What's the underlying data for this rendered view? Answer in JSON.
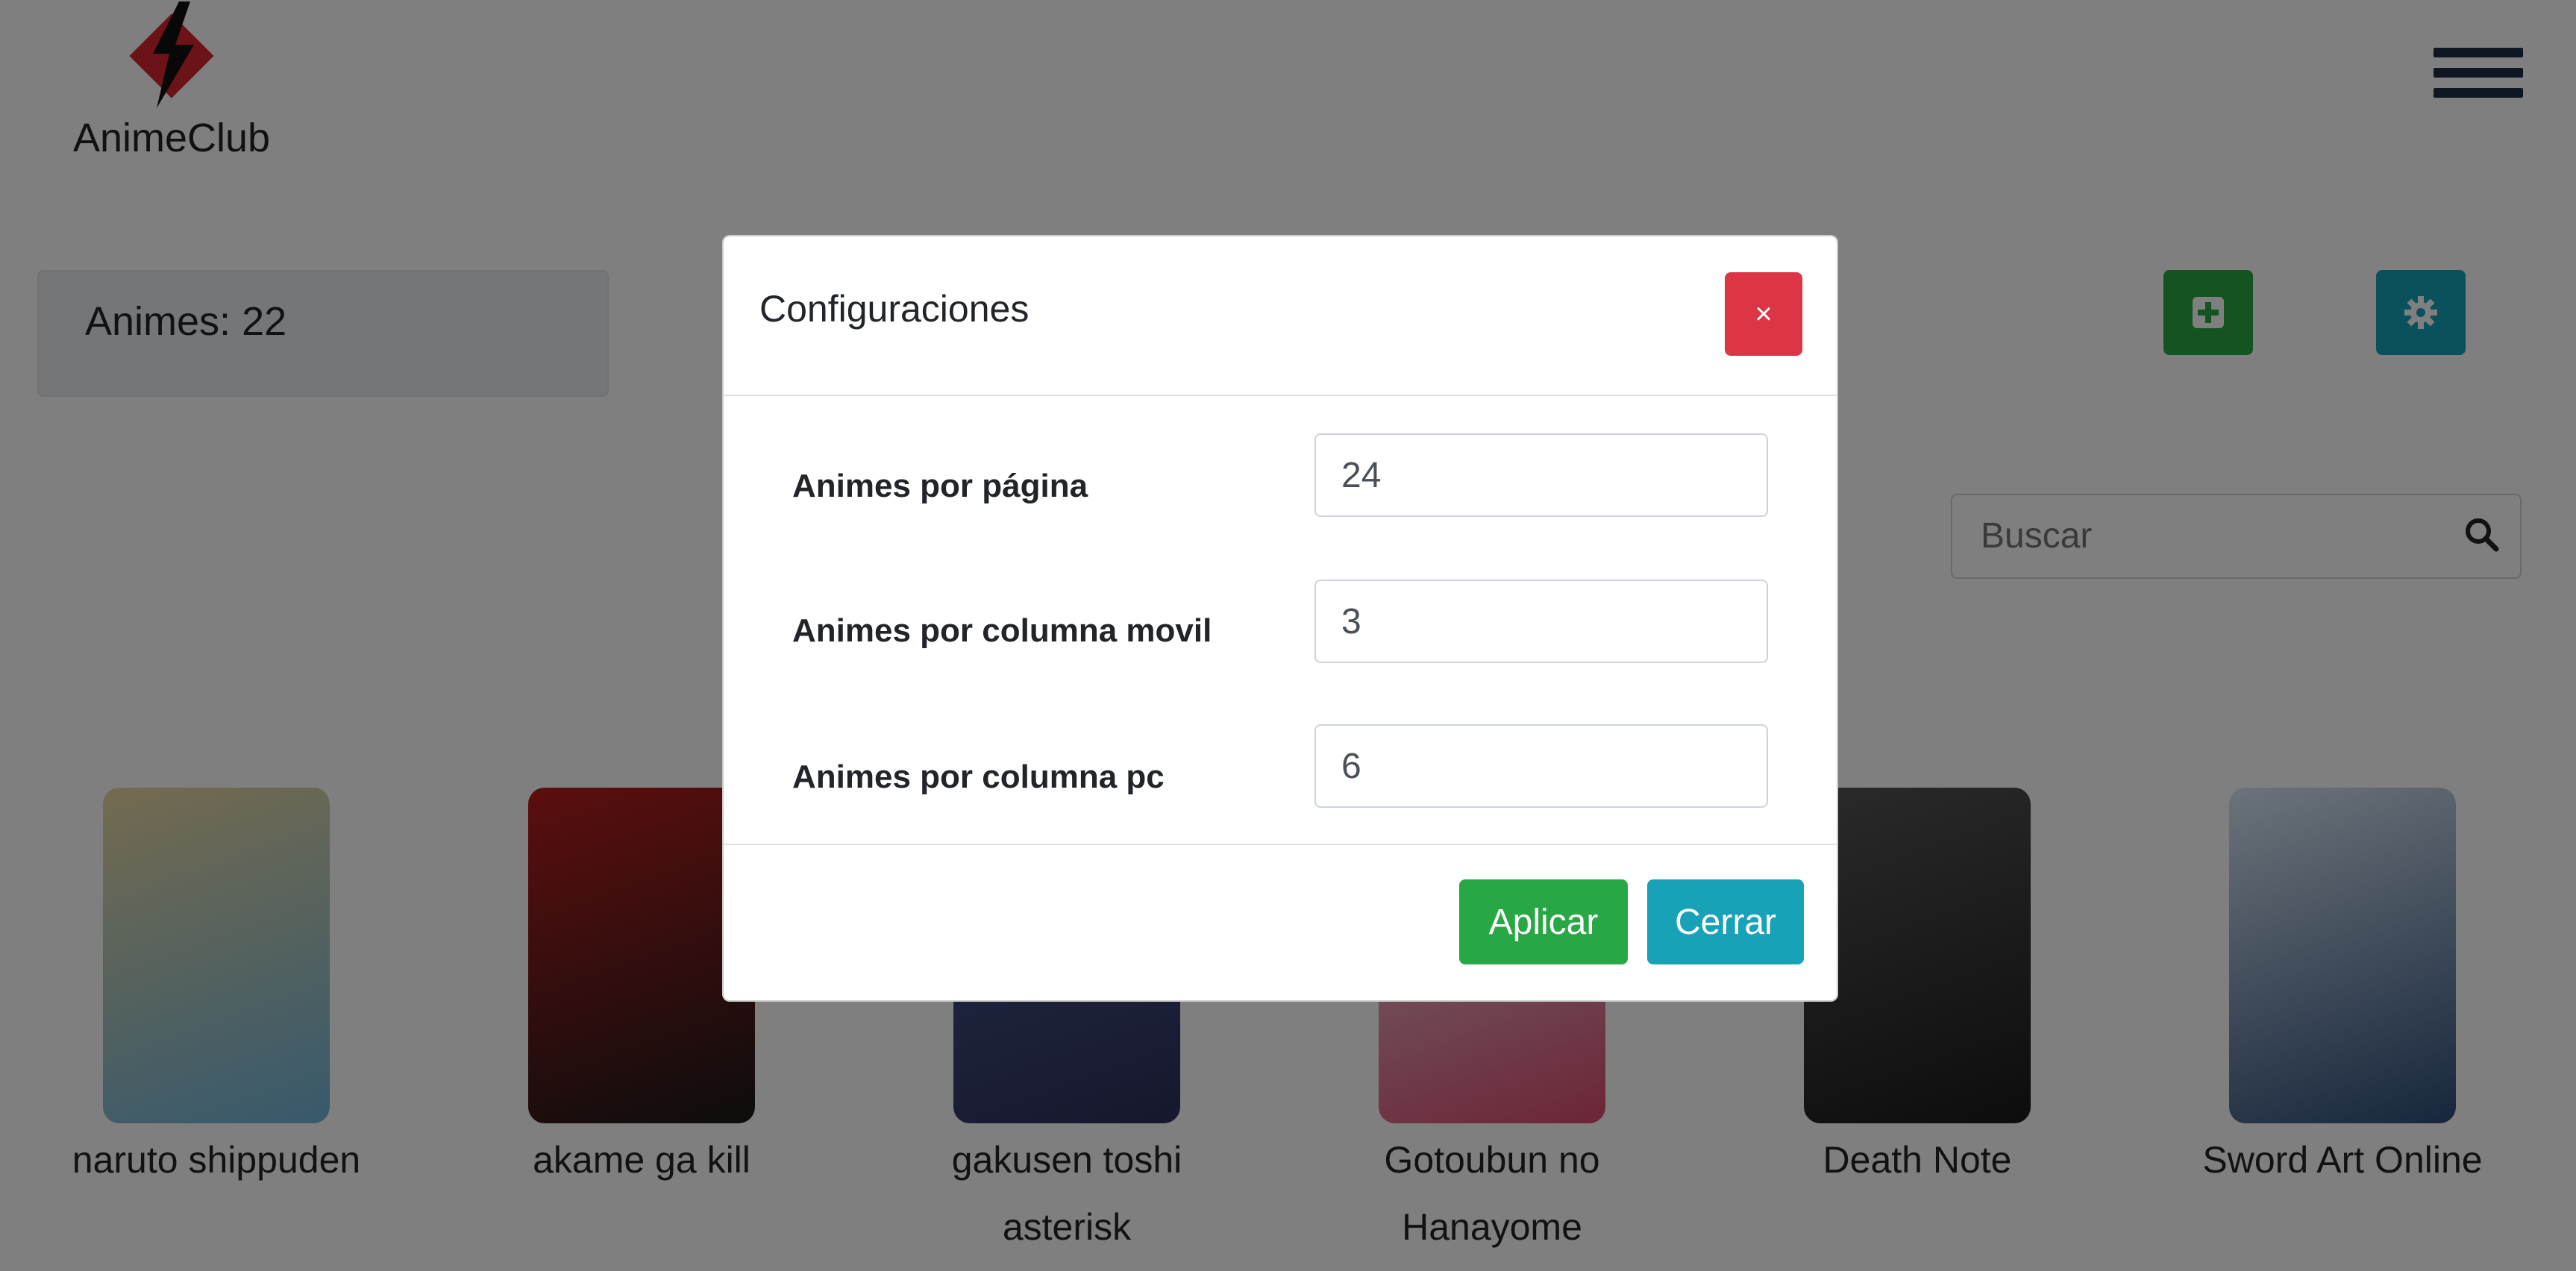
{
  "header": {
    "logo_text": "AnimeClub"
  },
  "stats": {
    "count_label": "Animes: 22"
  },
  "search": {
    "placeholder": "Buscar"
  },
  "cards": [
    {
      "line1": "naruto shippuden",
      "line2": "",
      "poster_colors": [
        "#e8d6a0",
        "#6fb3d9"
      ]
    },
    {
      "line1": "akame ga kill",
      "line2": "",
      "poster_colors": [
        "#b81d1d",
        "#1a1a1a"
      ]
    },
    {
      "line1": "gakusen toshi",
      "line2": "asterisk",
      "poster_colors": [
        "#4b5e9a",
        "#2c2f5a"
      ]
    },
    {
      "line1": "Gotoubun no",
      "line2": "Hanayome",
      "poster_colors": [
        "#e8e6f0",
        "#d94b6e"
      ]
    },
    {
      "line1": "Death Note",
      "line2": "",
      "poster_colors": [
        "#555555",
        "#1a1a1a"
      ]
    },
    {
      "line1": "Sword Art Online",
      "line2": "",
      "poster_colors": [
        "#d8e8f4",
        "#2f4d7a"
      ]
    }
  ],
  "modal": {
    "title": "Configuraciones",
    "close_symbol": "×",
    "fields": [
      {
        "label": "Animes por página",
        "value": "24"
      },
      {
        "label": "Animes por columna movil",
        "value": "3"
      },
      {
        "label": "Animes por columna pc",
        "value": "6"
      }
    ],
    "apply_label": "Aplicar",
    "cancel_label": "Cerrar"
  },
  "colors": {
    "success": "#28a745",
    "info": "#17a2b8",
    "danger": "#dc3545",
    "logo_red": "#d7262d"
  },
  "icons": [
    "lightning-logo-icon",
    "hamburger-icon",
    "plus-square-icon",
    "gear-icon",
    "search-icon",
    "close-icon"
  ]
}
